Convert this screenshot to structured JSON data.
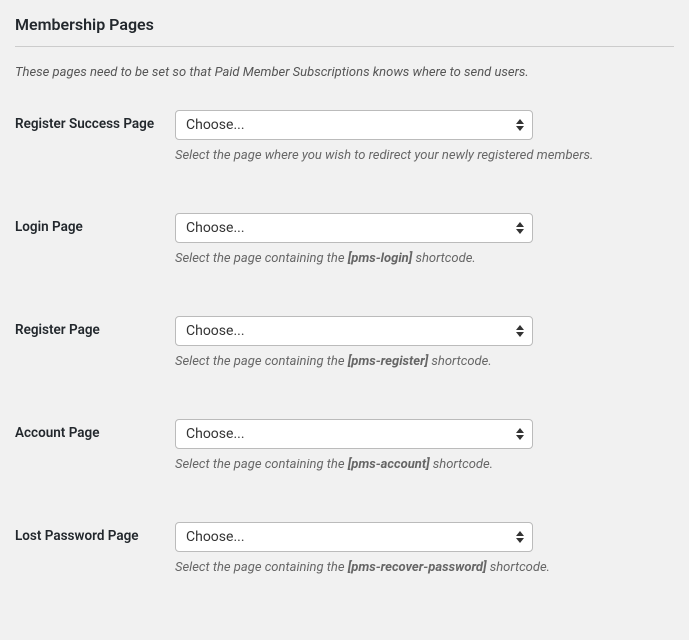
{
  "title": "Membership Pages",
  "description": "These pages need to be set so that Paid Member Subscriptions knows where to send users.",
  "choose_label": "Choose...",
  "fields": {
    "register_success": {
      "label": "Register Success Page",
      "help": "Select the page where you wish to redirect your newly registered members."
    },
    "login": {
      "label": "Login Page",
      "help_pre": "Select the page containing the ",
      "help_code": "[pms-login]",
      "help_post": " shortcode."
    },
    "register": {
      "label": "Register Page",
      "help_pre": "Select the page containing the ",
      "help_code": "[pms-register]",
      "help_post": " shortcode."
    },
    "account": {
      "label": "Account Page",
      "help_pre": "Select the page containing the ",
      "help_code": "[pms-account]",
      "help_post": " shortcode."
    },
    "lost_password": {
      "label": "Lost Password Page",
      "help_pre": "Select the page containing the ",
      "help_code": "[pms-recover-password]",
      "help_post": " shortcode."
    }
  }
}
